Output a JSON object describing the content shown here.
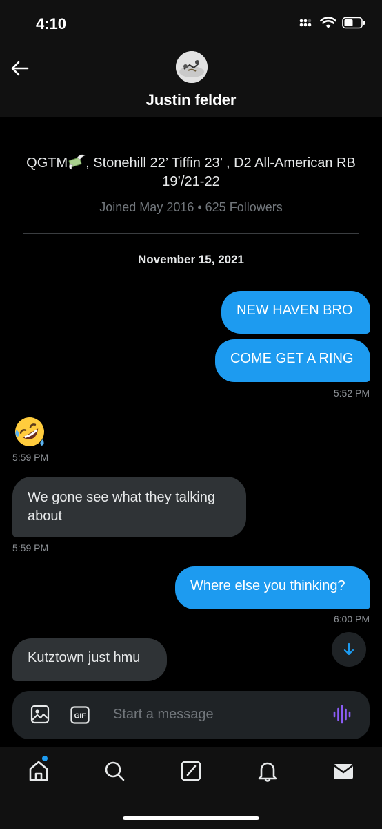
{
  "status_bar": {
    "time": "4:10",
    "icons": [
      "signal-icon",
      "wifi-icon",
      "battery-icon"
    ]
  },
  "header": {
    "back_icon": "back-arrow-icon",
    "name": "Justin felder"
  },
  "profile": {
    "bio_before_emoji": "QGTM",
    "bio_after_emoji": ", Stonehill 22’ Tiffin 23’ , D2 All-American RB 19’/21-22",
    "meta": "Joined May 2016 • 625 Followers"
  },
  "conversation": {
    "date": "November 15, 2021",
    "messages": [
      {
        "dir": "out",
        "text": "NEW HAVEN BRO"
      },
      {
        "dir": "out",
        "text": "COME GET A RING",
        "time": "5:52 PM"
      },
      {
        "dir": "in",
        "emoji": "rolling-on-floor-laughing-emoji",
        "time": "5:59 PM"
      },
      {
        "dir": "in",
        "text": "We gone see what they talking about",
        "time": "5:59 PM"
      },
      {
        "dir": "out",
        "text": "Where else you thinking?",
        "time": "6:00 PM"
      },
      {
        "dir": "in",
        "text": "Kutztown just hmu"
      }
    ]
  },
  "composer": {
    "placeholder": "Start a message",
    "gif_label": "GIF",
    "icons": [
      "image-icon",
      "gif-icon",
      "voice-icon"
    ]
  },
  "tab_bar": {
    "tabs": [
      "home-icon",
      "search-icon",
      "grok-icon",
      "notifications-icon",
      "messages-icon"
    ]
  },
  "colors": {
    "accent": "#1d9bf0",
    "incoming_bubble": "#2f3336",
    "background": "#000000",
    "muted_text": "#71767b",
    "voice_icon": "#8b5cf6"
  }
}
